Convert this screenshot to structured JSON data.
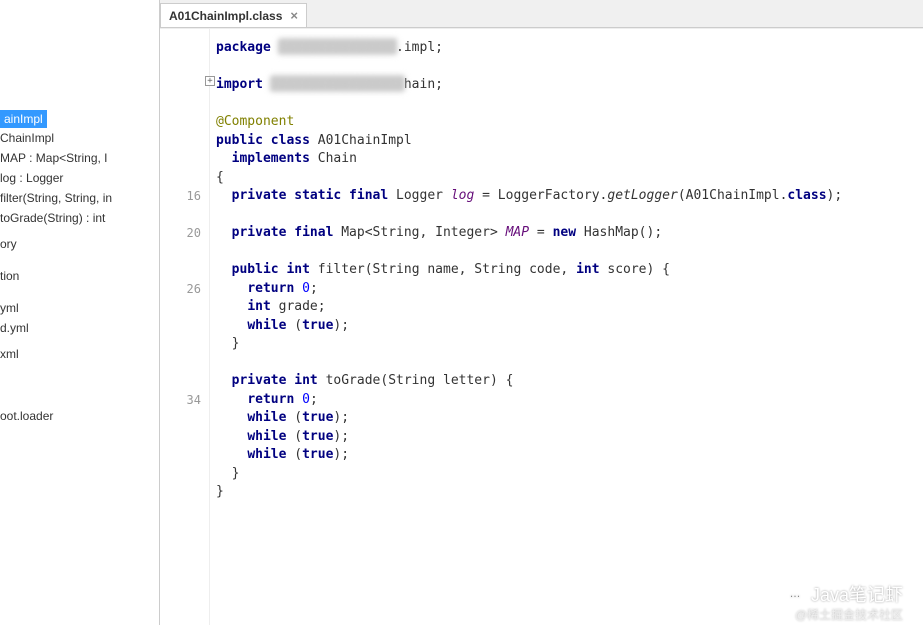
{
  "tab": {
    "label": "A01ChainImpl.class",
    "close": "×"
  },
  "sidebar": {
    "items": [
      "ainImpl",
      "ChainImpl",
      "MAP : Map<String, I",
      "log : Logger",
      "filter(String, String, in",
      "toGrade(String) : int",
      "",
      "ory",
      "",
      "",
      "tion",
      "",
      "",
      "yml",
      "d.yml",
      "",
      "xml",
      "",
      "",
      "",
      "",
      "",
      "",
      "",
      "oot.loader"
    ]
  },
  "gutter": {
    "lines": [
      "",
      "",
      "",
      "",
      "",
      "",
      "",
      "",
      "16",
      "",
      "20",
      "",
      "",
      "26",
      "",
      "",
      "",
      "",
      "",
      "34",
      "",
      "",
      "",
      "",
      ""
    ],
    "fold": "+"
  },
  "code": {
    "l1_kw": "package",
    "l1_blur": "▓▓▓▓▓▓▓▓▓▓▓▓▓▓▓",
    "l1_tail": ".impl;",
    "l3_kw": "import",
    "l3_blur": "▓▓▓▓▓▓▓▓▓▓▓▓▓▓▓▓▓",
    "l3_tail": "hain;",
    "l5_ann": "@Component",
    "l6_kw1": "public class",
    "l6_cls": "A01ChainImpl",
    "l7_kw": "implements",
    "l7_iface": "Chain",
    "l8": "{",
    "l9_kw": "private static final",
    "l9_type": "Logger",
    "l9_var": "log",
    "l9_eq": "=",
    "l9_factory": "LoggerFactory",
    "l9_dot": ".",
    "l9_method": "getLogger",
    "l9_arg": "(A01ChainImpl.",
    "l9_class": "class",
    "l9_end": ");",
    "l11_kw": "private final",
    "l11_type": "Map<String, Integer>",
    "l11_var": "MAP",
    "l11_eq": "=",
    "l11_new": "new",
    "l11_ctor": "HashMap();",
    "l13_kw": "public int",
    "l13_name": "filter",
    "l13_params": "(String name, String code,",
    "l13_intkw": "int",
    "l13_pend": "score) {",
    "l14_kw": "return",
    "l14_val": "0",
    "l14_semi": ";",
    "l15_kw": "int",
    "l15_var": "grade;",
    "l16_kw": "while",
    "l16_paren": "(",
    "l16_true": "true",
    "l16_end": ");",
    "l17": "}",
    "l19_kw": "private int",
    "l19_name": "toGrade",
    "l19_params": "(String letter) {",
    "l20_kw": "return",
    "l20_val": "0",
    "l20_semi": ";",
    "l21_kw": "while",
    "l21_paren": "(",
    "l21_true": "true",
    "l21_end": ");",
    "l22_kw": "while",
    "l22_paren": "(",
    "l22_true": "true",
    "l22_end": ");",
    "l23_kw": "while",
    "l23_paren": "(",
    "l23_true": "true",
    "l23_end": ");",
    "l24": "}",
    "l25": "}"
  },
  "watermark": {
    "main": "Java笔记虾",
    "sub": "@稀土掘金技术社区",
    "icon": "…"
  }
}
